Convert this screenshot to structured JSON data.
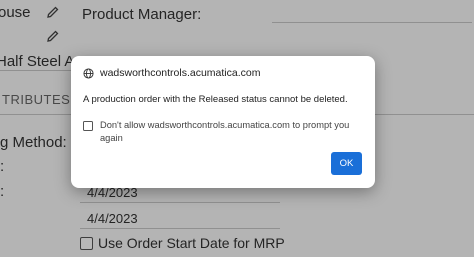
{
  "form": {
    "field_house_value": "ouse",
    "product_manager_label": "Product Manager:",
    "item_value": "Half Steel Assy",
    "attributes_tab": "TRIBUTES",
    "method_label": "g Method:",
    "colon_1": ":",
    "colon_2": ":",
    "date_1": "4/4/2023",
    "date_2": "4/4/2023",
    "checkbox_label": "Use Order Start Date for MRP"
  },
  "dialog": {
    "title": "wadsworthcontrols.acumatica.com",
    "message": "A production order with the Released status cannot be deleted.",
    "checkbox_label": "Don't allow wadsworthcontrols.acumatica.com to prompt you again",
    "ok_label": "OK"
  },
  "icons": [
    "pencil-icon",
    "globe-icon",
    "checkbox-icon"
  ],
  "colors": {
    "ok_button": "#1a6fd8",
    "overlay": "rgba(0,0,0,0.28)"
  }
}
